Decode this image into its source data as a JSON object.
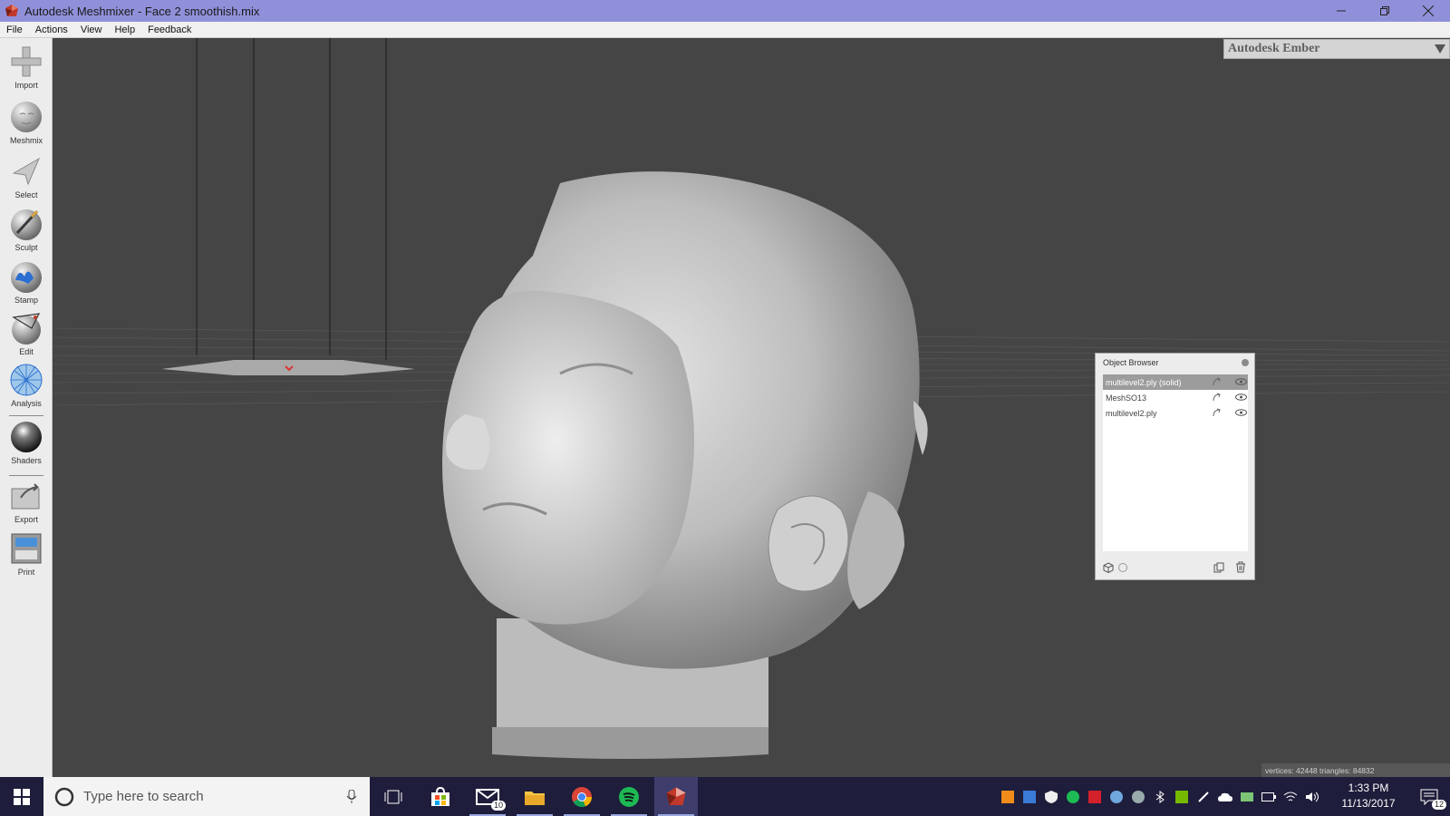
{
  "window": {
    "title": "Autodesk Meshmixer - Face 2 smoothish.mix"
  },
  "menu": [
    "File",
    "Actions",
    "View",
    "Help",
    "Feedback"
  ],
  "tools": [
    {
      "label": "Import",
      "icon": "import-icon"
    },
    {
      "label": "Meshmix",
      "icon": "meshmix-icon"
    },
    {
      "label": "Select",
      "icon": "select-icon"
    },
    {
      "label": "Sculpt",
      "icon": "sculpt-icon"
    },
    {
      "label": "Stamp",
      "icon": "stamp-icon"
    },
    {
      "label": "Edit",
      "icon": "edit-icon"
    },
    {
      "label": "Analysis",
      "icon": "analysis-icon"
    },
    {
      "label": "Shaders",
      "icon": "shaders-icon"
    },
    {
      "label": "Export",
      "icon": "export-icon"
    },
    {
      "label": "Print",
      "icon": "print-icon"
    }
  ],
  "printer": {
    "selected": "Autodesk Ember"
  },
  "object_browser": {
    "title": "Object Browser",
    "items": [
      {
        "name": "multilevel2.ply (solid)",
        "selected": true
      },
      {
        "name": "MeshSO13",
        "selected": false
      },
      {
        "name": "multilevel2.ply",
        "selected": false
      }
    ]
  },
  "status": {
    "stats": "vertices: 42448 triangles: 84832"
  },
  "taskbar": {
    "search_placeholder": "Type here to search",
    "mail_badge": "10",
    "time": "1:33 PM",
    "date": "11/13/2017",
    "notification_count": "12"
  },
  "colors": {
    "titlebar": "#9090da",
    "viewport": "#454545",
    "taskbar": "#1e1d3b"
  }
}
